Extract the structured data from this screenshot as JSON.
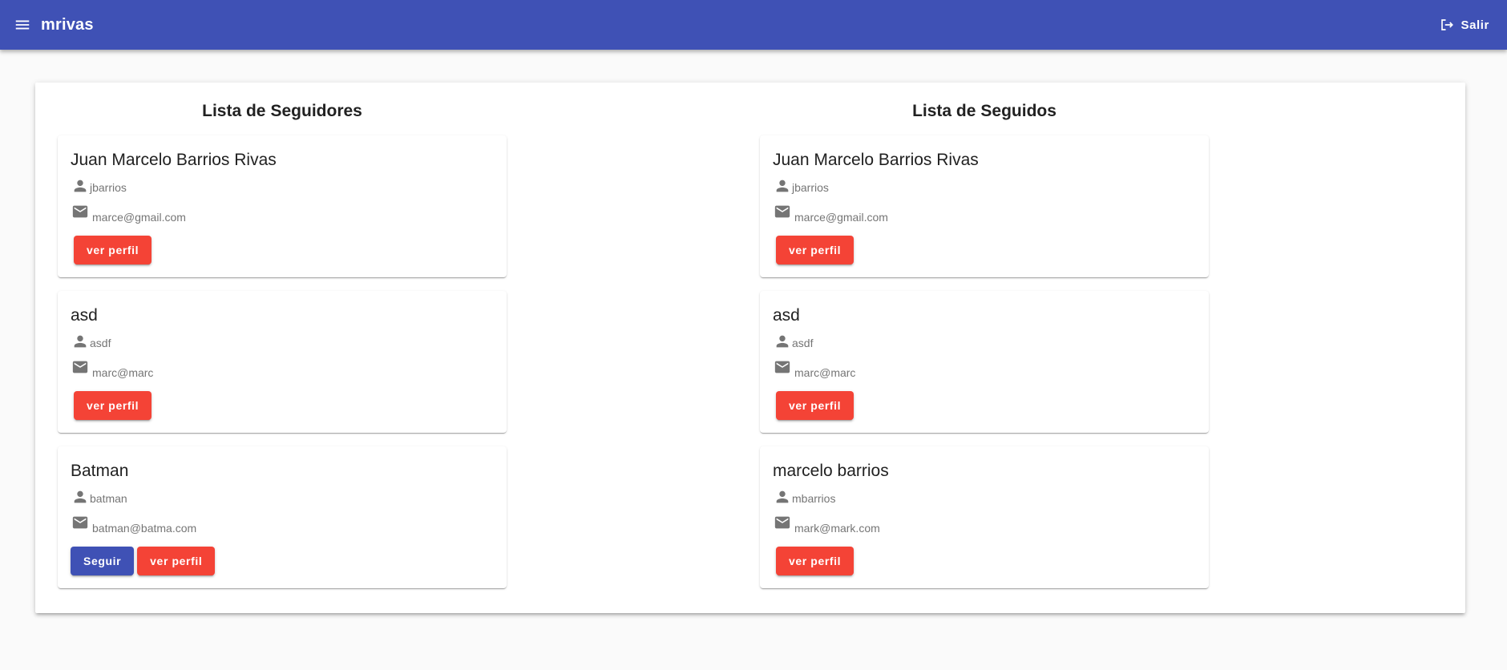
{
  "app": {
    "brand": "mrivas",
    "logout_label": "Salir"
  },
  "colors": {
    "primary": "#3f51b5",
    "warn": "#f44336",
    "background": "#fafafa"
  },
  "followers": {
    "title_prefix": "Lista de",
    "title_bold": "Seguidores",
    "cards": [
      {
        "name": "Juan Marcelo Barrios Rivas",
        "username": "jbarrios",
        "email": "marce@gmail.com",
        "profile_label": "ver perfil"
      },
      {
        "name": "asd",
        "username": "asdf",
        "email": "marc@marc",
        "profile_label": "ver perfil"
      },
      {
        "name": "Batman",
        "username": "batman",
        "email": "batman@batma.com",
        "follow_label": "Seguir",
        "profile_label": "ver perfil"
      }
    ]
  },
  "following": {
    "title_prefix": "Lista de",
    "title_bold": "Seguidos",
    "cards": [
      {
        "name": "Juan Marcelo Barrios Rivas",
        "username": "jbarrios",
        "email": "marce@gmail.com",
        "profile_label": "ver perfil"
      },
      {
        "name": "asd",
        "username": "asdf",
        "email": "marc@marc",
        "profile_label": "ver perfil"
      },
      {
        "name": "marcelo barrios",
        "username": "mbarrios",
        "email": "mark@mark.com",
        "profile_label": "ver perfil"
      }
    ]
  },
  "icons": {
    "menu": "menu-icon",
    "logout": "logout-icon",
    "user": "person-icon",
    "email": "email-icon"
  }
}
